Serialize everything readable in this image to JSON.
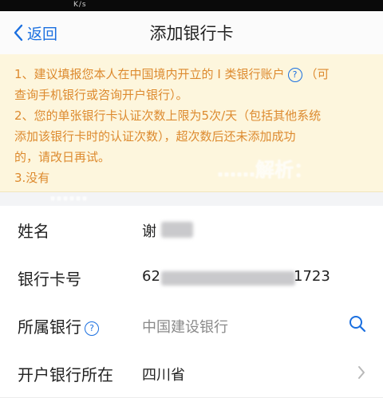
{
  "status": {
    "signal": "K/s",
    "time": ""
  },
  "nav": {
    "back_label": "返回",
    "title": "添加银行卡"
  },
  "notice": {
    "line1": "1、建议填报您本人在中国境内开立的 I 类银行账户",
    "line1_suffix": "（可",
    "line2": "查询手机银行或咨询开户银行）。",
    "line3": "2、您的单张银行卡认证次数上限为5次/天（包括其他系统",
    "line4": "添加该银行卡时的认证次数），超次数后还未添加成功",
    "line5": "的，请改日再试。",
    "line6": "3.没有"
  },
  "watermark": {
    "line1": "……解析：",
    "line2": "……"
  },
  "form": {
    "name_label": "姓名",
    "name_value": "谢",
    "card_label": "银行卡号",
    "card_prefix": "62",
    "card_suffix": "1723",
    "bank_label": "所属银行",
    "bank_placeholder": "中国建设银行",
    "location_label": "开户银行所在",
    "location_value": "四川省"
  },
  "colors": {
    "accent": "#1a6fe0",
    "notice_text": "#dd8a2e",
    "notice_bg": "#fdf6dd"
  },
  "icons": {
    "back": "chevron-left-icon",
    "help": "question-circle-icon",
    "search": "search-icon",
    "chevron": "chevron-right-icon"
  }
}
